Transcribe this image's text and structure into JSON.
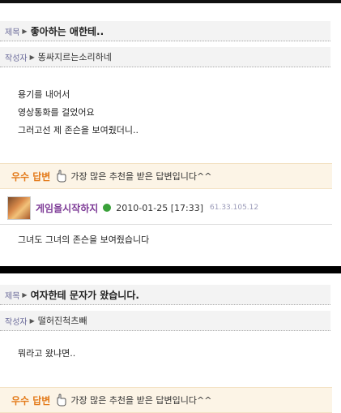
{
  "post1": {
    "title_label": "제목",
    "title": "좋아하는 애한테..",
    "author_label": "작성자",
    "author": "똥싸지르는소리하네",
    "body_lines": [
      "용기를 내어서",
      "영상통화를 걸었어요",
      "그러고선 제 존슨을 보여줬더니.."
    ],
    "best_label": "우수 답변",
    "best_desc": "가장 많은 추천을 받은 답변입니다^^",
    "answerer": "게임을시작하지",
    "answer_date": "2010-01-25 [17:33]",
    "answer_ip": "61.33.105.12",
    "answer_text": "그녀도 그녀의 존슨을 보여줬습니다"
  },
  "post2": {
    "title_label": "제목",
    "title": "여자한테 문자가 왔습니다.",
    "author_label": "작성자",
    "author": "떨허진척츠빼",
    "body_lines": [
      "뭐라고 왔냐면.."
    ],
    "best_label": "우수 답변",
    "best_desc": "가장 많은 추천을 받은 답변입니다^^"
  },
  "colors": {
    "best_label": "#e37a1a",
    "answerer": "#7d3a96",
    "best_bar_bg": "#fcf4e6"
  },
  "icons": {
    "hand": "pointing-hand-icon",
    "level": "green-level-icon",
    "arrow": "right-triangle-icon"
  }
}
